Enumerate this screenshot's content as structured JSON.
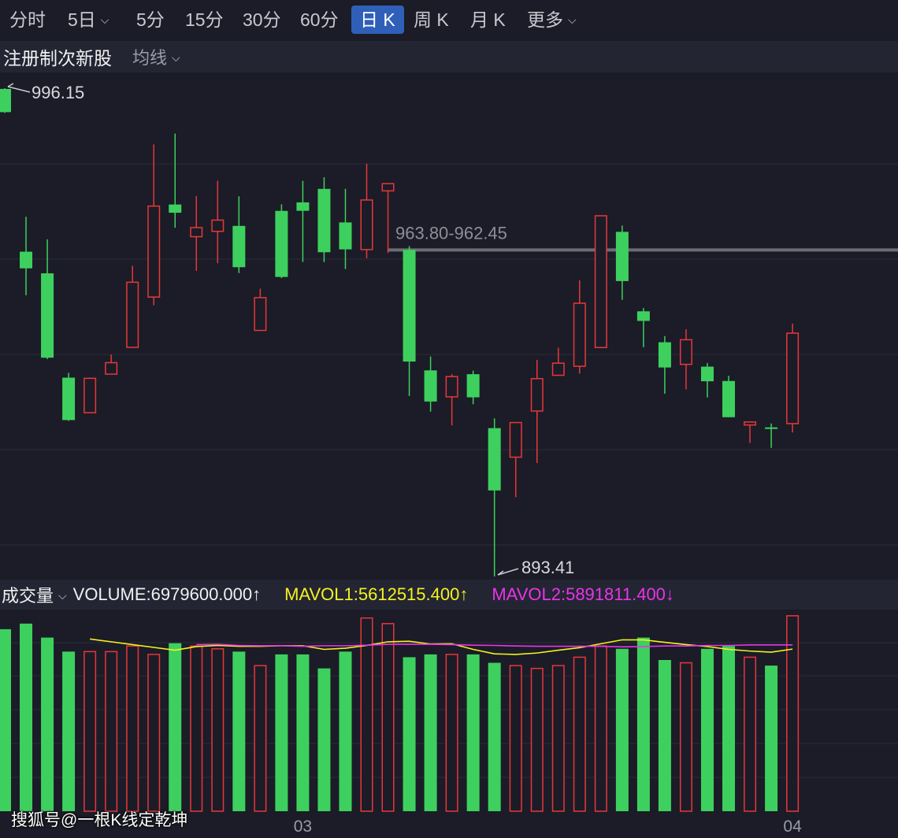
{
  "tabs": [
    {
      "label": "分时",
      "active": false,
      "dropdown": false
    },
    {
      "label": "5日",
      "active": false,
      "dropdown": true
    },
    {
      "label": "5分",
      "active": false,
      "dropdown": false
    },
    {
      "label": "15分",
      "active": false,
      "dropdown": false
    },
    {
      "label": "30分",
      "active": false,
      "dropdown": false
    },
    {
      "label": "60分",
      "active": false,
      "dropdown": false
    },
    {
      "label": "日 K",
      "active": true,
      "dropdown": false
    },
    {
      "label": "周 K",
      "active": false,
      "dropdown": false
    },
    {
      "label": "月 K",
      "active": false,
      "dropdown": false
    },
    {
      "label": "更多",
      "active": false,
      "dropdown": true
    }
  ],
  "stock_name": "注册制次新股",
  "ma_selector": "均线",
  "volume_panel": {
    "title": "成交量",
    "volume_text": "VOLUME:6979600.000↑",
    "mavol1_text": "MAVOL1:5612515.400↑",
    "mavol2_text": "MAVOL2:5891811.400↓"
  },
  "watermark": "搜狐号@一根K线定乾坤",
  "colors": {
    "up": "#e8373a",
    "down": "#3ed05e",
    "mavol1": "#f5f21e",
    "mavol2": "#e934e9",
    "background": "#1b1c27",
    "level_line": "#6c6d75"
  },
  "chart_data": [
    {
      "type": "candlestick",
      "price_range": [
        893.41,
        996.15
      ],
      "annotations": {
        "high_label": "996.15",
        "low_label": "893.41",
        "level_label": "963.80-962.45",
        "level_value": 962.45
      },
      "x_labels": [
        {
          "index": 14,
          "text": "03"
        },
        {
          "index": 37,
          "text": "04"
        }
      ],
      "candles": [
        {
          "o": 996.0,
          "h": 996.15,
          "l": 990.95,
          "c": 991.12
        },
        {
          "o": 961.75,
          "h": 969.1,
          "l": 952.6,
          "c": 958.25
        },
        {
          "o": 957.2,
          "h": 964.35,
          "l": 939.15,
          "c": 939.45
        },
        {
          "o": 935.25,
          "h": 936.25,
          "l": 926.16,
          "c": 926.33
        },
        {
          "o": 927.88,
          "h": 935.3,
          "l": 927.88,
          "c": 935.11
        },
        {
          "o": 935.99,
          "h": 940.12,
          "l": 935.99,
          "c": 938.4
        },
        {
          "o": 941.62,
          "h": 958.78,
          "l": 941.62,
          "c": 955.33
        },
        {
          "o": 952.21,
          "h": 984.33,
          "l": 950.49,
          "c": 971.35
        },
        {
          "o": 971.68,
          "h": 986.61,
          "l": 966.79,
          "c": 969.95
        },
        {
          "o": 964.91,
          "h": 973.46,
          "l": 957.7,
          "c": 966.83
        },
        {
          "o": 966.04,
          "h": 976.69,
          "l": 959.33,
          "c": 968.4
        },
        {
          "o": 967.18,
          "h": 973.41,
          "l": 957.26,
          "c": 958.49
        },
        {
          "o": 945.19,
          "h": 953.98,
          "l": 947.24,
          "c": 952.09
        },
        {
          "o": 970.34,
          "h": 971.72,
          "l": 956.2,
          "c": 956.44
        },
        {
          "o": 972.13,
          "h": 976.67,
          "l": 959.59,
          "c": 970.36
        },
        {
          "o": 974.97,
          "h": 977.42,
          "l": 959.56,
          "c": 961.64
        },
        {
          "o": 967.91,
          "h": 974.98,
          "l": 958.12,
          "c": 962.24
        },
        {
          "o": 962.2,
          "h": 980.27,
          "l": 960.37,
          "c": 972.63
        },
        {
          "o": 974.55,
          "h": 975.24,
          "l": 961.47,
          "c": 976.07
        },
        {
          "o": 962.13,
          "h": 962.93,
          "l": 931.38,
          "c": 938.64
        },
        {
          "o": 936.78,
          "h": 939.71,
          "l": 928.1,
          "c": 930.23
        },
        {
          "o": 931.22,
          "h": 935.98,
          "l": 925.2,
          "c": 935.48
        },
        {
          "o": 935.98,
          "h": 936.72,
          "l": 929.66,
          "c": 931.11
        },
        {
          "o": 924.63,
          "h": 926.68,
          "l": 893.41,
          "c": 911.52
        },
        {
          "o": 918.52,
          "h": 919.41,
          "l": 910.11,
          "c": 925.8
        },
        {
          "o": 928.23,
          "h": 939.0,
          "l": 917.29,
          "c": 935.05
        },
        {
          "o": 935.75,
          "h": 941.55,
          "l": 939.59,
          "c": 938.3
        },
        {
          "o": 937.64,
          "h": 955.73,
          "l": 936.1,
          "c": 950.91
        },
        {
          "o": 941.59,
          "h": 968.41,
          "l": 956.4,
          "c": 969.31
        },
        {
          "o": 965.93,
          "h": 967.25,
          "l": 951.62,
          "c": 955.57
        },
        {
          "o": 949.21,
          "h": 949.91,
          "l": 941.66,
          "c": 947.19
        },
        {
          "o": 942.7,
          "h": 944.0,
          "l": 931.86,
          "c": 937.39
        },
        {
          "o": 938.05,
          "h": 945.46,
          "l": 932.77,
          "c": 943.23
        },
        {
          "o": 937.57,
          "h": 938.33,
          "l": 931.08,
          "c": 934.49
        },
        {
          "o": 934.55,
          "h": 935.63,
          "l": 927.04,
          "c": 926.93
        },
        {
          "o": 925.29,
          "h": 926.05,
          "l": 921.52,
          "c": 925.93
        },
        {
          "o": 924.79,
          "h": 925.61,
          "l": 920.47,
          "c": 924.51
        },
        {
          "o": 925.58,
          "h": 946.63,
          "l": 923.72,
          "c": 944.61
        }
      ],
      "volume": [
        6.5,
        6.7,
        6.2,
        5.7,
        5.7,
        5.7,
        5.9,
        5.6,
        6.0,
        5.9,
        5.8,
        5.7,
        5.2,
        5.6,
        5.6,
        5.1,
        5.7,
        6.9,
        6.7,
        5.5,
        5.6,
        5.6,
        5.6,
        5.3,
        5.2,
        5.1,
        5.2,
        5.5,
        5.9,
        5.8,
        6.2,
        5.4,
        5.3,
        5.8,
        5.9,
        5.5,
        5.2,
        6.98
      ],
      "mavol1": [
        null,
        null,
        null,
        null,
        6.15,
        6.05,
        5.95,
        5.85,
        5.75,
        5.88,
        5.92,
        5.89,
        5.89,
        5.91,
        5.91,
        5.78,
        5.82,
        5.92,
        6.05,
        6.07,
        5.97,
        5.98,
        5.78,
        5.62,
        5.6,
        5.65,
        5.75,
        5.84,
        5.98,
        6.12,
        6.12,
        6.03,
        5.95,
        5.88,
        5.78,
        5.72,
        5.68,
        5.79
      ],
      "mavol2": [
        null,
        null,
        null,
        null,
        null,
        null,
        null,
        null,
        null,
        5.95,
        5.96,
        5.92,
        5.91,
        5.91,
        5.89,
        5.91,
        5.91,
        5.93,
        5.96,
        5.96,
        5.96,
        5.95,
        5.93,
        5.92,
        5.9,
        5.89,
        5.89,
        5.89,
        5.89,
        5.87,
        5.88,
        5.9,
        5.9,
        5.92,
        5.92,
        5.94,
        5.94,
        5.94
      ]
    }
  ]
}
